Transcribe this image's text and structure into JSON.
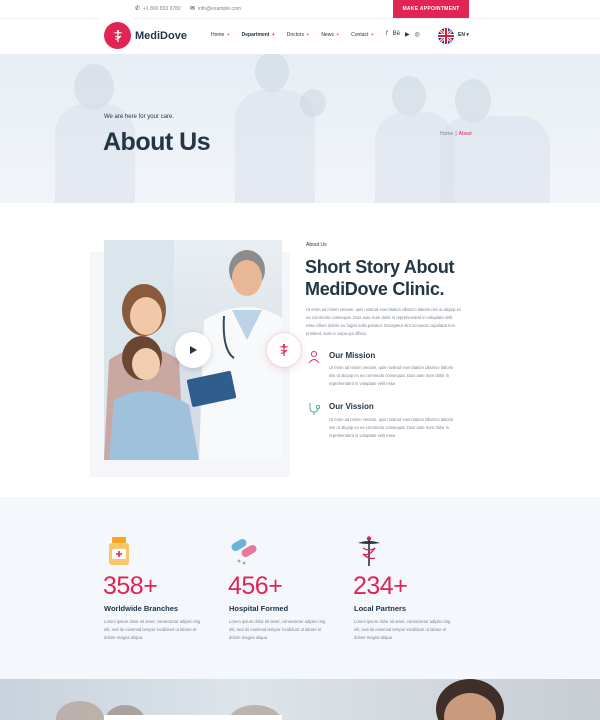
{
  "topbar": {
    "phone": "+1 800 833 9780",
    "email": "info@example.com",
    "appointment_button": "MAKE APPOINTMENT"
  },
  "header": {
    "brand": "MediDove",
    "nav": [
      {
        "label": "Home",
        "caret": "+"
      },
      {
        "label": "Department",
        "caret": "+"
      },
      {
        "label": "Doctors",
        "caret": "+"
      },
      {
        "label": "News",
        "caret": "+"
      },
      {
        "label": "Contact",
        "caret": "+"
      }
    ],
    "social_icons": [
      "facebook-icon",
      "behance-icon",
      "youtube-icon",
      "dribbble-icon"
    ],
    "social_glyphs": [
      "f",
      "Bē",
      "▶",
      "◎"
    ],
    "language": "EN",
    "language_caret": "▾"
  },
  "hero": {
    "subtitle": "We are here for your care.",
    "title": "About Us",
    "breadcrumb_home": "Home",
    "breadcrumb_sep": "|",
    "breadcrumb_current": "About"
  },
  "about": {
    "tag": "About Us",
    "title": "Short Story About MediDove Clinic.",
    "text": "Ut enim ad minim veniam, quis nostrud exercitation ullamco laboris nisi ut aliquip ex ea commodo consequat. Duis aute irure dolor in reprehenderit in voluptate velit esse cillum dolore eu fugiat nulla pariatur. Excepteur sint occaecat cupidatat non proident, sunt in culpa qui officia.",
    "mission_title": "Our Mission",
    "mission_text": "Ut enim ad minim veniam, quis nostrud exercitation ullamco laboris nisi ut aliquip ex ea commodo consequat. Duis aute irure dolor in reprehenderit in voluptate velit esse.",
    "vision_title": "Our Vission",
    "vision_text": "Ut enim ad minim veniam, quis nostrud exercitation ullamco laboris nisi ut aliquip ex ea commodo consequat. Duis aute irure dolor in reprehenderit in voluptate velit esse."
  },
  "stats": [
    {
      "number": "358+",
      "title": "Worldwide Branches",
      "text": "Lorem ipsum dolor sit amet, consectetur adipisi cing elit, sed do eiusmod tempor incididunt ut labore et dolore magna aliqua.",
      "icon": "medicine-bottle-icon"
    },
    {
      "number": "456+",
      "title": "Hospital Formed",
      "text": "Lorem ipsum dolor sit amet, consectetur adipisi cing elit, sed do eiusmod tempor incididunt ut labore et dolore magna aliqua.",
      "icon": "pills-icon"
    },
    {
      "number": "234+",
      "title": "Local Partners",
      "text": "Lorem ipsum dolor sit amet, consectetur adipisi cing elit, sed do eiusmod tempor incididunt ut labore et dolore magna aliqua.",
      "icon": "caduceus-icon"
    }
  ],
  "colors": {
    "accent": "#e12454",
    "heading": "#223645",
    "body_text": "#7b8591",
    "stats_bg": "#f4f7fb"
  }
}
